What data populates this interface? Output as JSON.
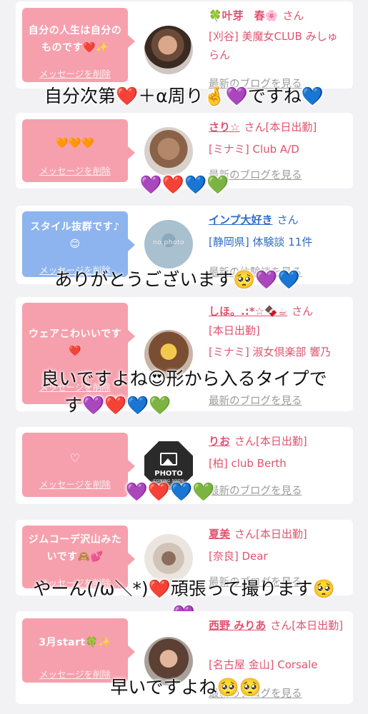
{
  "cards": [
    {
      "bubble_text": "自分の人生は自分のものです❤️✨",
      "delete_label": "メッセージを削除",
      "avatar_icon": "avatar-photo",
      "name": "🍀叶芽　春🌸",
      "san": "さん",
      "status": "",
      "shop": "[刈谷] 美魔女CLUB みしゅらん",
      "more_link": "最新のブログを見る",
      "caption": "自分次第❤️＋α周り🤞💜ですね💙"
    },
    {
      "bubble_text": "🧡🧡🧡",
      "delete_label": "メッセージを削除",
      "avatar_icon": "avatar-photo",
      "name": "さり☆",
      "san": "さん",
      "status": "[本日出勤]",
      "shop": "[ミナミ] Club A/D",
      "more_link": "最新のブログを見る",
      "caption": "💜❤️💙💚"
    },
    {
      "bubble_text": "スタイル抜群です♪😊",
      "delete_label": "メッセージを削除",
      "avatar_icon": "no-photo-icon",
      "avatar_label": "no photo",
      "name": "インプ大好き",
      "san": "さん",
      "status": "",
      "shop": "[静岡県] 体験談 11件",
      "more_link": "最新の体験談を見る",
      "caption": "ありがとうございます🥺💜💙"
    },
    {
      "bubble_text": "ウェアこわいいです❤️",
      "delete_label": "メッセージを削除",
      "avatar_icon": "avatar-photo",
      "name": "しほ。.:*☆🍫☕",
      "san": "さん",
      "status": "[本日出勤]",
      "shop": "[ミナミ] 淑女倶楽部 響乃",
      "more_link": "最新のブログを見る",
      "caption_line1": "良いですよね😍形から入るタイプで",
      "caption_line2": "す💜❤️💙💚"
    },
    {
      "bubble_text": "♡",
      "delete_label": "メッセージを削除",
      "avatar_icon": "photo-coming-soon-icon",
      "avatar_title": "PHOTO",
      "avatar_sub": "COMING SOON",
      "name": "りお",
      "san": "さん",
      "status": "[本日出勤]",
      "shop": "[柏] club Berth",
      "more_link": "最新のブログを見る",
      "caption": "💜❤️💙💚"
    },
    {
      "bubble_text": "ジムコーデ沢山みたいです🙈💕",
      "delete_label": "メッセージを削除",
      "avatar_icon": "avatar-photo",
      "name": "夏美",
      "san": "さん",
      "status": "[本日出勤]",
      "shop": "[奈良] Dear",
      "more_link": "最新のブログを見る",
      "caption_line1": "やーん(/ω＼*)❤️頑張って撮ります🥺",
      "caption_line2": "💜"
    },
    {
      "bubble_text": "3月start🍀✨",
      "delete_label": "メッセージを削除",
      "avatar_icon": "avatar-photo",
      "name": "西野 みりあ",
      "san": "さん",
      "status": "[本日出勤]",
      "shop": "[名古屋 金山] Corsale",
      "more_link": "最新のブログを見る",
      "caption": "早いですよね🥺🥺"
    }
  ]
}
